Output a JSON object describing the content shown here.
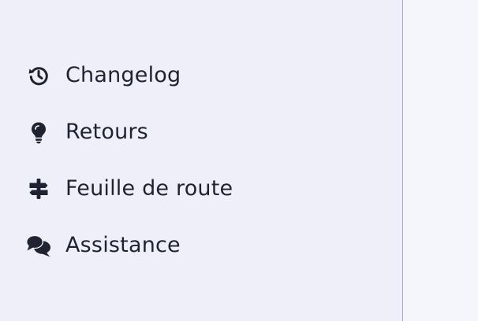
{
  "colors": {
    "sidebar_bg": "#eeeff8",
    "main_bg": "#f5f6fb",
    "text": "#1f2230",
    "divider": "#a9aac8"
  },
  "menu": {
    "items": [
      {
        "label": "Changelog",
        "icon": "history-icon"
      },
      {
        "label": "Retours",
        "icon": "lightbulb-icon"
      },
      {
        "label": "Feuille de route",
        "icon": "signpost-icon"
      },
      {
        "label": "Assistance",
        "icon": "comments-icon"
      }
    ]
  }
}
